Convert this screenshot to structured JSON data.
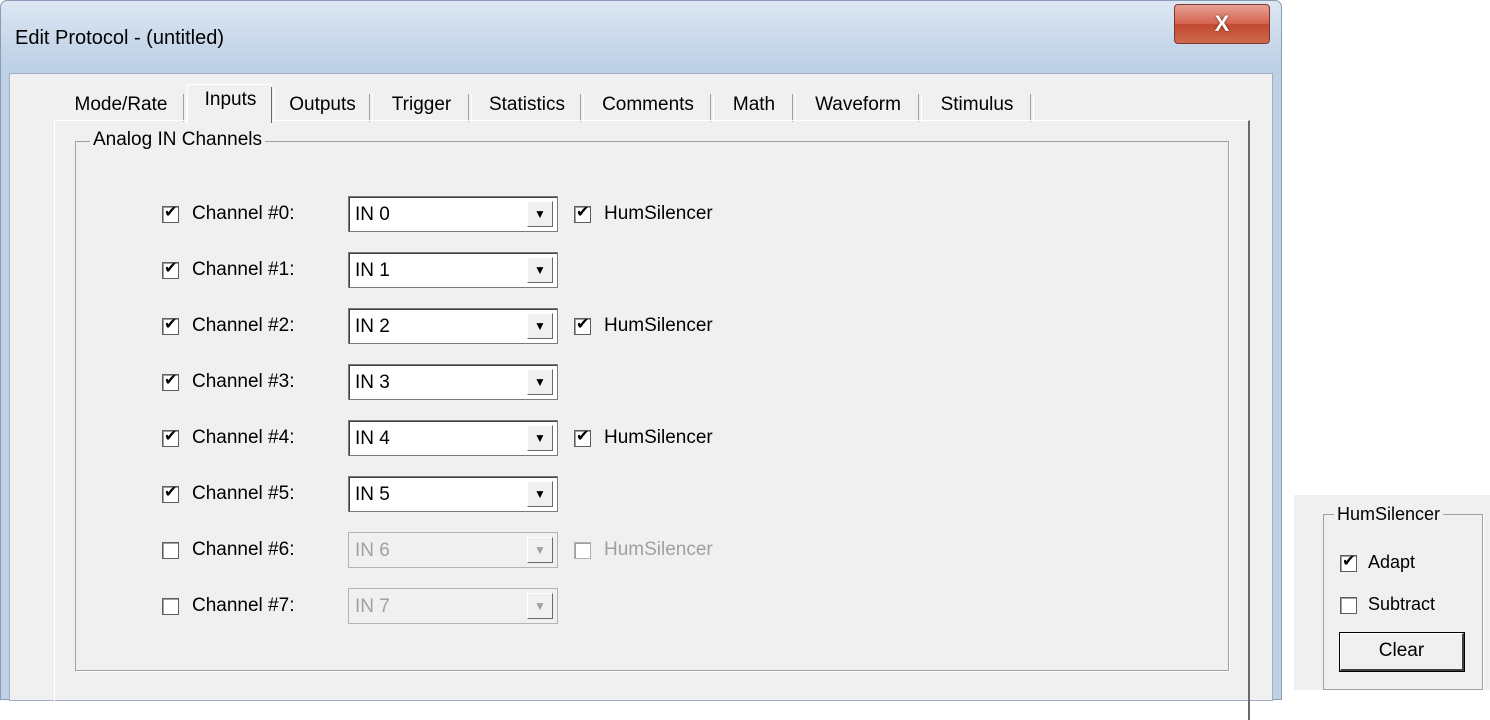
{
  "window": {
    "title": "Edit Protocol - (untitled)",
    "close_glyph": "X"
  },
  "tabs": [
    {
      "label": "Mode/Rate",
      "active": false
    },
    {
      "label": "Inputs",
      "active": true
    },
    {
      "label": "Outputs",
      "active": false
    },
    {
      "label": "Trigger",
      "active": false
    },
    {
      "label": "Statistics",
      "active": false
    },
    {
      "label": "Comments",
      "active": false
    },
    {
      "label": "Math",
      "active": false
    },
    {
      "label": "Waveform",
      "active": false
    },
    {
      "label": "Stimulus",
      "active": false
    }
  ],
  "analog_group": {
    "title": "Analog IN Channels",
    "channels": [
      {
        "label": "Channel #0:",
        "enabled": true,
        "input": "IN 0",
        "humsilencer_label": "HumSilencer",
        "humsilencer": true
      },
      {
        "label": "Channel #1:",
        "enabled": true,
        "input": "IN 1"
      },
      {
        "label": "Channel #2:",
        "enabled": true,
        "input": "IN 2",
        "humsilencer_label": "HumSilencer",
        "humsilencer": true
      },
      {
        "label": "Channel #3:",
        "enabled": true,
        "input": "IN 3"
      },
      {
        "label": "Channel #4:",
        "enabled": true,
        "input": "IN 4",
        "humsilencer_label": "HumSilencer",
        "humsilencer": true
      },
      {
        "label": "Channel #5:",
        "enabled": true,
        "input": "IN 5"
      },
      {
        "label": "Channel #6:",
        "enabled": false,
        "input": "IN 6",
        "humsilencer_label": "HumSilencer",
        "humsilencer": false
      },
      {
        "label": "Channel #7:",
        "enabled": false,
        "input": "IN 7"
      }
    ]
  },
  "humsilencer_panel": {
    "title": "HumSilencer",
    "adapt_label": "Adapt",
    "adapt_checked": true,
    "subtract_label": "Subtract",
    "subtract_checked": false,
    "clear_label": "Clear"
  },
  "colors": {
    "title_bar": "#c9d8ea",
    "dialog_bg": "#f0f0f0",
    "close_button": "#c94a36",
    "disabled_text": "#a0a0a0"
  }
}
